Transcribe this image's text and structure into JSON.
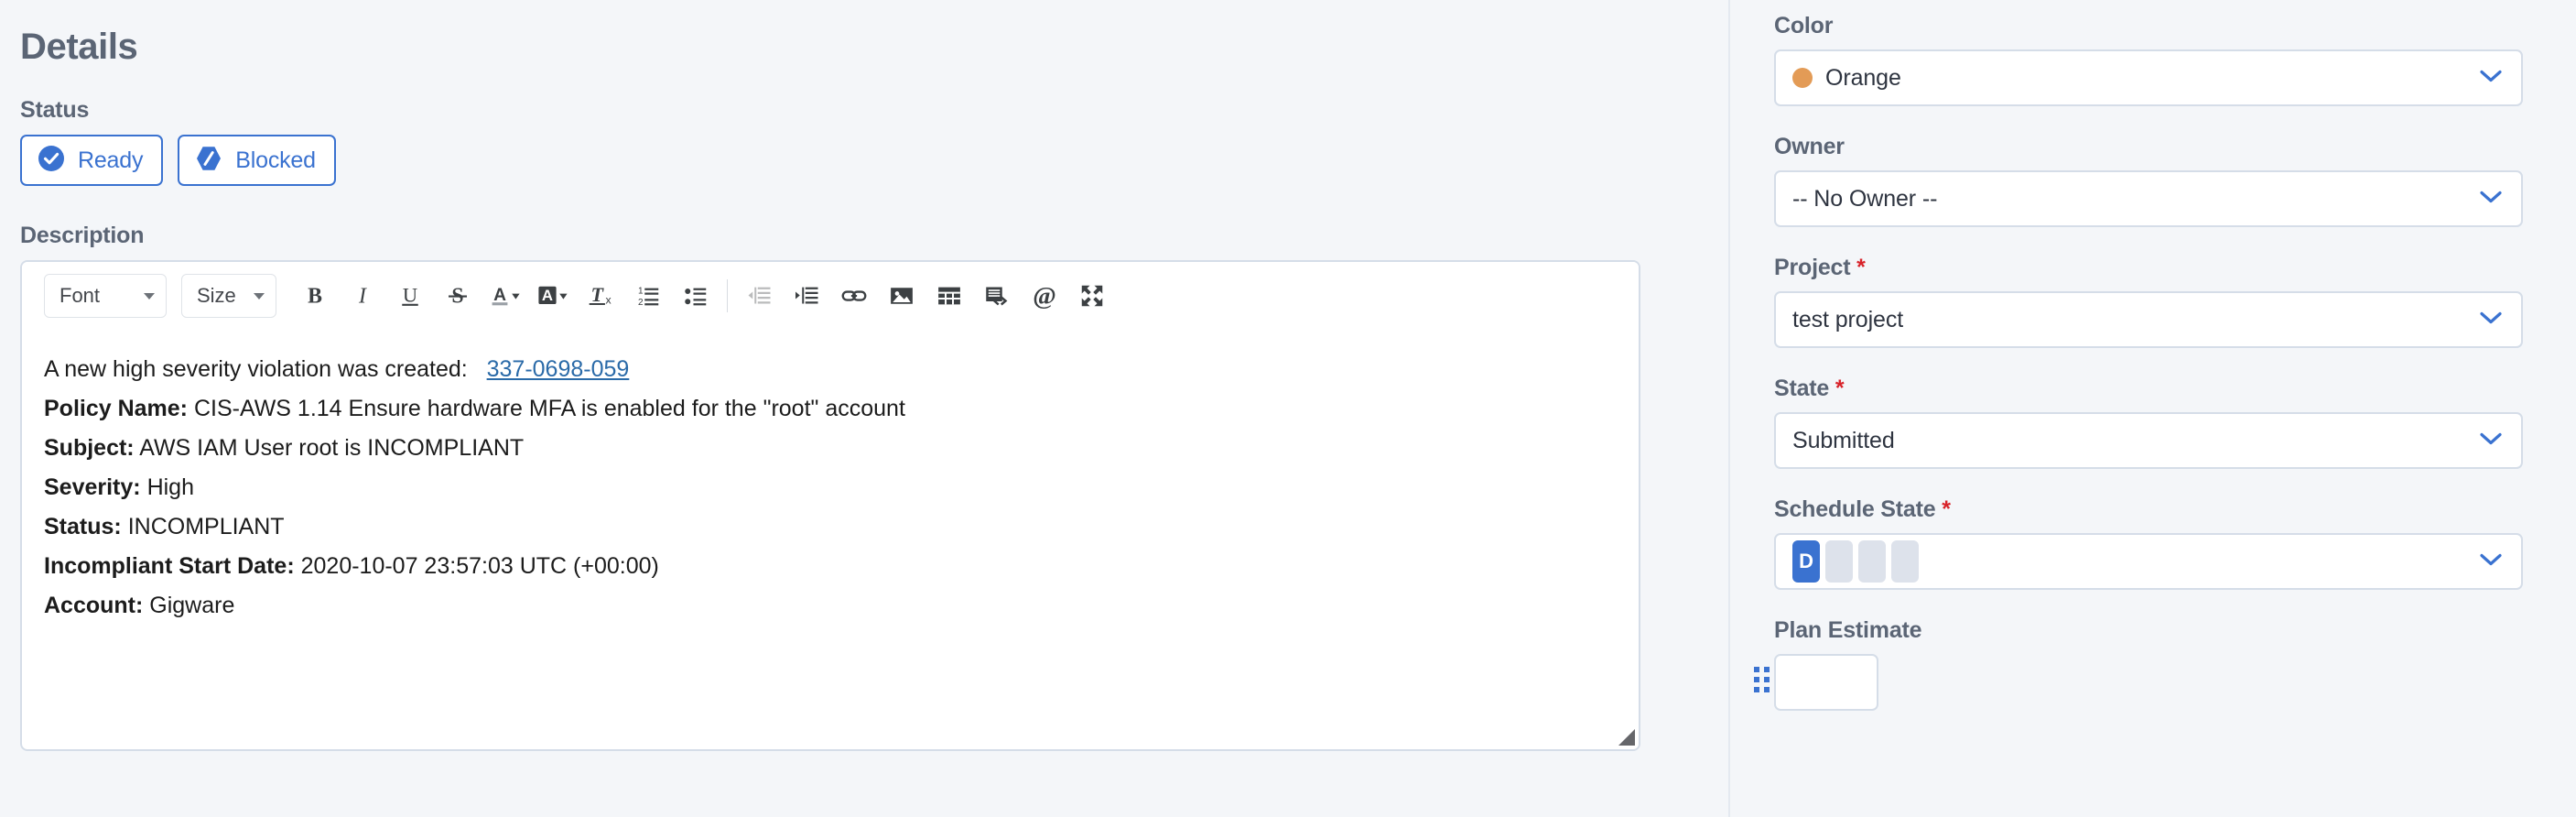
{
  "details": {
    "title": "Details",
    "status": {
      "label": "Status",
      "buttons": [
        {
          "label": "Ready",
          "icon": "check-circle-icon"
        },
        {
          "label": "Blocked",
          "icon": "blocked-hexagon-icon"
        }
      ]
    },
    "description": {
      "label": "Description",
      "toolbar": {
        "font_label": "Font",
        "size_label": "Size",
        "buttons": [
          {
            "name": "bold-button",
            "glyph": "B"
          },
          {
            "name": "italic-button",
            "glyph": "I"
          },
          {
            "name": "underline-button",
            "glyph": "U"
          },
          {
            "name": "strikethrough-button",
            "glyph": "S"
          },
          {
            "name": "text-color-button",
            "glyph": "A"
          },
          {
            "name": "highlight-color-button",
            "glyph": "A"
          },
          {
            "name": "remove-format-button",
            "glyph": "Tx"
          },
          {
            "name": "numbered-list-button",
            "glyph": "1/2"
          },
          {
            "name": "bulleted-list-button",
            "glyph": "bullets"
          },
          {
            "name": "outdent-button",
            "glyph": "outdent"
          },
          {
            "name": "indent-button",
            "glyph": "indent"
          },
          {
            "name": "link-button",
            "glyph": "link"
          },
          {
            "name": "image-button",
            "glyph": "image"
          },
          {
            "name": "table-button",
            "glyph": "table"
          },
          {
            "name": "source-code-button",
            "glyph": "code"
          },
          {
            "name": "mention-button",
            "glyph": "@"
          },
          {
            "name": "fullscreen-button",
            "glyph": "expand"
          }
        ]
      },
      "content": {
        "intro_text": "A new high severity violation was created:",
        "violation_link": "337-0698-059",
        "rows": [
          {
            "key": "Policy Name:",
            "value": "CIS-AWS 1.14 Ensure hardware MFA is enabled for the \"root\" account"
          },
          {
            "key": "Subject:",
            "value": "AWS IAM User root is INCOMPLIANT"
          },
          {
            "key": "Severity:",
            "value": "High"
          },
          {
            "key": "Status:",
            "value": "INCOMPLIANT"
          },
          {
            "key": "Incompliant Start Date:",
            "value": "2020-10-07 23:57:03 UTC (+00:00)"
          },
          {
            "key": "Account:",
            "value": "Gigware"
          }
        ]
      }
    }
  },
  "sidebar": {
    "color": {
      "label": "Color",
      "value": "Orange",
      "swatch_hex": "#e39b56",
      "required": false
    },
    "owner": {
      "label": "Owner",
      "value": "-- No Owner --",
      "required": false
    },
    "project": {
      "label": "Project",
      "value": "test project",
      "required": true,
      "required_marker": "*"
    },
    "state": {
      "label": "State",
      "value": "Submitted",
      "required": true,
      "required_marker": "*"
    },
    "schedule_state": {
      "label": "Schedule State",
      "required": true,
      "required_marker": "*",
      "active_letter": "D",
      "total_steps": 4,
      "active_step": 1,
      "active_hex": "#3a72d0",
      "inactive_hex": "#dde2eb"
    },
    "plan_estimate": {
      "label": "Plan Estimate",
      "value": "",
      "required": false
    }
  },
  "theme": {
    "accent_hex": "#3a72d0",
    "background_hex": "#f4f6f9",
    "border_hex": "#d5dde8",
    "label_hex": "#5b6575",
    "link_hex": "#2a6aa8",
    "required_hex": "#d8232a"
  }
}
